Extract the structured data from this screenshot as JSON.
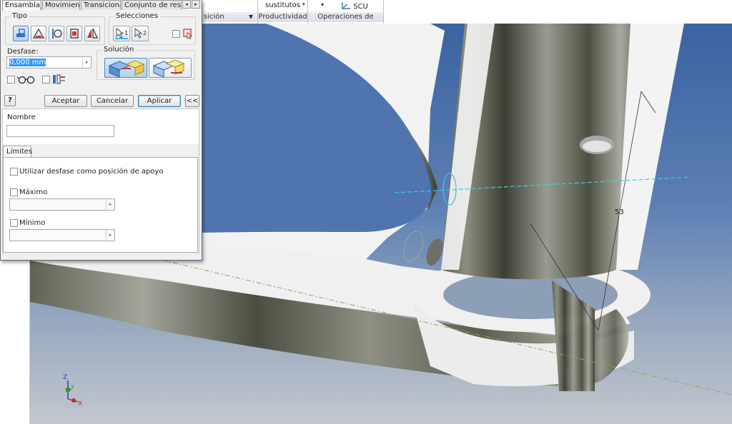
{
  "ribbon": {
    "partial_label": "sición",
    "sustitutos_label": "sustitutos",
    "scu_label": "SCU",
    "group_productividad": "Productividad",
    "group_operaciones": "Operaciones de trabajo"
  },
  "dialog": {
    "tabs": [
      "Ensamblaje",
      "Movimiento",
      "Transicional",
      "Conjunto de restricc"
    ],
    "tipo_label": "Tipo",
    "selecciones_label": "Selecciones",
    "selection_1": "1",
    "selection_2": "2",
    "desfase_label": "Desfase:",
    "desfase_value": "0,000 mm",
    "solucion_label": "Solución",
    "help_label": "?",
    "aceptar_label": "Aceptar",
    "cancelar_label": "Cancelar",
    "aplicar_label": "Aplicar",
    "expand_label": "<<",
    "nombre_label": "Nombre",
    "nombre_value": "",
    "limites_tab": "Límites",
    "utilizar_desfase_label": "Utilizar desfase como posición de apoyo",
    "maximo_label": "Máximo",
    "minimo_label": "Mínimo"
  },
  "viewport": {
    "dimension_text": "53",
    "axis_x": "X",
    "axis_y": "Y",
    "axis_z": "Z"
  },
  "colors": {
    "sky_top": "#3b62a1",
    "dimension_line": "#40c8e8",
    "axis_line": "#a0a060"
  }
}
